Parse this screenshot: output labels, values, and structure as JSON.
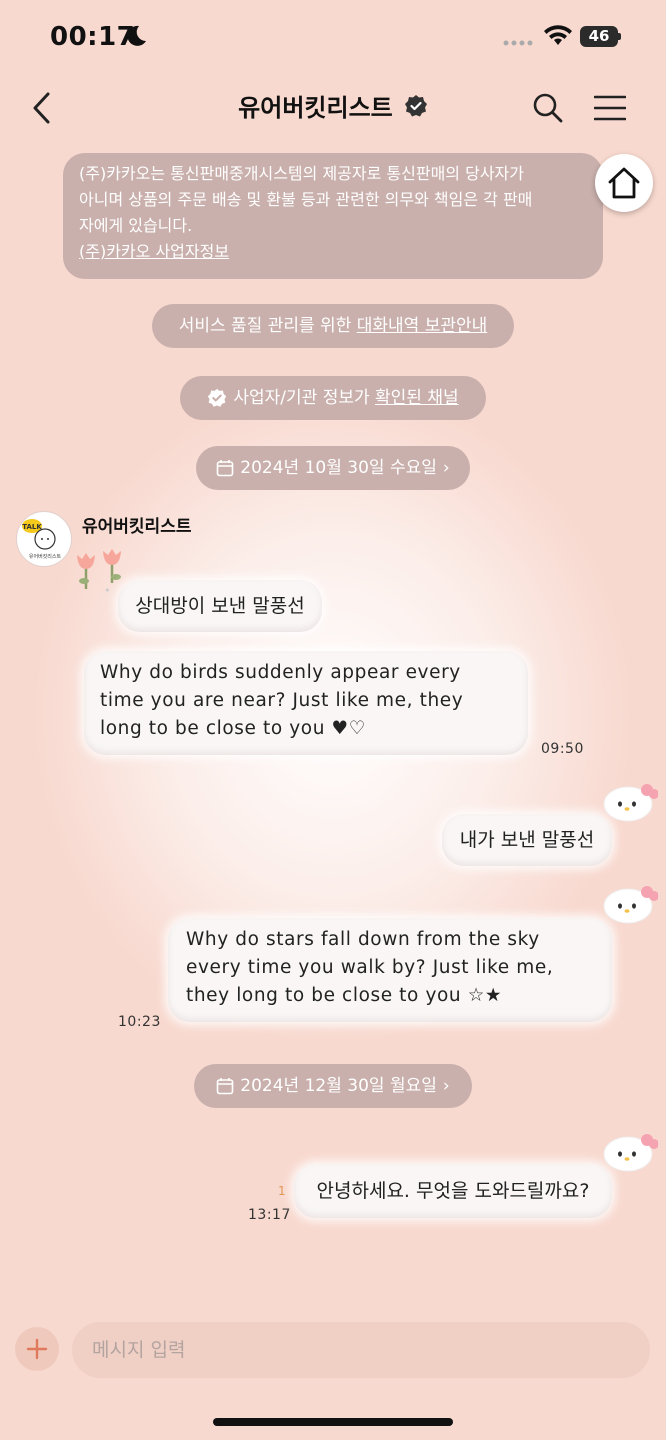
{
  "status_bar": {
    "time": "00:17",
    "battery": "46"
  },
  "header": {
    "title": "유어버킷리스트"
  },
  "notice": {
    "lines": [
      "(주)카카오는 통신판매중개시스템의 제공자로 통신판매의 당사자가",
      "아니며 상품의 주문 배송 및 환불 등과 관련한 의무와 책임은 각 판매",
      "자에게 있습니다."
    ],
    "link": "(주)카카오 사업자정보"
  },
  "pills": {
    "service_prefix": "서비스 품질 관리를 위한 ",
    "service_link": "대화내역 보관안내",
    "verified_prefix": "사업자/기관 정보가 ",
    "verified_link": "확인된 채널",
    "date1": "2024년 10월 30일 수요일",
    "date2": "2024년 12월 30일 월요일"
  },
  "profile": {
    "name": "유어버킷리스트",
    "avatar_label": "TALK",
    "avatar_sublabel": "유어버킷리스트"
  },
  "messages": {
    "m1": "상대방이 보낸 말풍선",
    "m2_lines": [
      "Why do birds suddenly appear every",
      "time you are near? Just like me, they",
      "long to be close to you ♥♡"
    ],
    "m2_time": "09:50",
    "m3": "내가 보낸 말풍선",
    "m4_lines": [
      "Why do stars fall down from the sky",
      "every time you walk by? Just like me,",
      "they long to be close to you ☆★"
    ],
    "m4_time": "10:23",
    "m5": "안녕하세요. 무엇을 도와드릴까요?",
    "m5_unread": "1",
    "m5_time": "13:17"
  },
  "input": {
    "placeholder": "메시지 입력"
  }
}
